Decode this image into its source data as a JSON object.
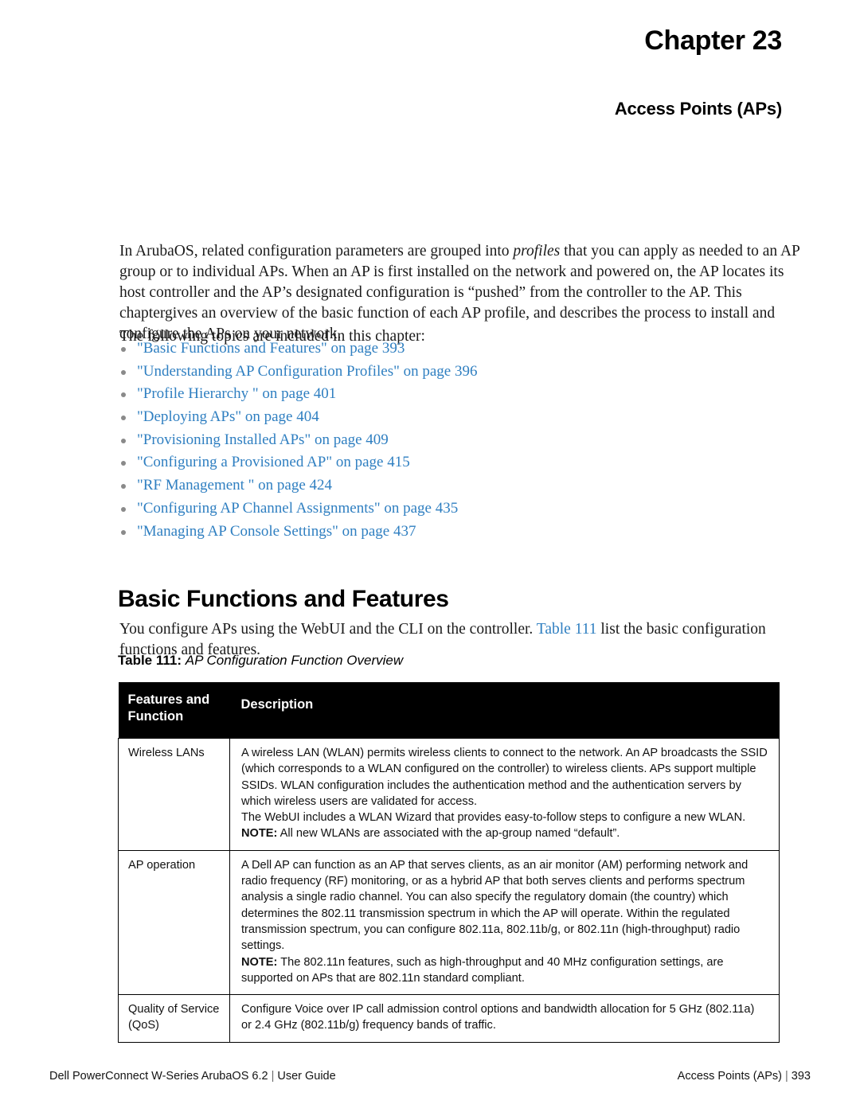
{
  "chapter": {
    "title": "Chapter 23",
    "subtitle": "Access Points (APs)"
  },
  "intro": {
    "part1": "In ArubaOS, related configuration parameters are grouped into ",
    "emphasis": "profiles",
    "part2": " that you can apply as needed to an AP group or to individual APs. When an AP is first installed on the network and powered on, the AP locates its host controller and the AP’s designated configuration is “pushed” from the controller to the AP. This chaptergives an overview of the basic function of each AP profile, and describes the process to install and configure the APs on your network.",
    "topics_lead": "The following topics are included in this chapter:"
  },
  "topics": [
    {
      "label": "\"Basic Functions and Features\" on page 393"
    },
    {
      "label": "\"Understanding AP Configuration Profiles\" on page 396"
    },
    {
      "label": "\"Profile Hierarchy \" on page 401"
    },
    {
      "label": "\"Deploying APs\" on page 404"
    },
    {
      "label": "\"Provisioning Installed APs\" on page 409"
    },
    {
      "label": "\"Configuring a Provisioned AP\" on page 415"
    },
    {
      "label": "\"RF Management \" on page 424"
    },
    {
      "label": "\"Configuring AP Channel Assignments\" on page 435"
    },
    {
      "label": "\"Managing AP Console Settings\" on page 437"
    }
  ],
  "section": {
    "heading": "Basic Functions and Features",
    "para_part1": "You configure APs using the WebUI and the CLI on the controller. ",
    "para_link": "Table 111",
    "para_part2": " list the basic configuration functions and features."
  },
  "table_caption": {
    "label": "Table 111:",
    "text": "AP Configuration Function Overview"
  },
  "table": {
    "headers": {
      "col1": "Features and Function",
      "col2": "Description"
    },
    "rows": [
      {
        "feature": "Wireless LANs",
        "paragraphs": [
          "A wireless LAN (WLAN) permits wireless clients to connect to the network. An AP broadcasts the SSID (which corresponds to a WLAN configured on the controller) to wireless clients. APs support multiple SSIDs. WLAN configuration includes the authentication method and the authentication servers by which wireless users are validated for access.",
          "The WebUI includes a WLAN Wizard that provides easy-to-follow steps to configure a new WLAN."
        ],
        "note_label": "NOTE:",
        "note_text": " All new WLANs are associated with the ap-group named “default”."
      },
      {
        "feature": "AP operation",
        "paragraphs": [
          "A  Dell AP can function as an AP that serves clients, as an air monitor (AM) performing network and radio frequency (RF) monitoring, or as a hybrid AP that both serves clients and performs spectrum analysis a single radio channel. You can also specify the regulatory domain (the country) which determines the 802.11 transmission spectrum in which the AP will operate. Within the regulated transmission spectrum, you can configure 802.11a, 802.11b/g, or 802.11n (high-throughput) radio settings."
        ],
        "note_label": "NOTE:",
        "note_text": " The 802.11n features, such as high-throughput and 40 MHz configuration settings, are supported on APs that are 802.11n standard compliant."
      },
      {
        "feature": "Quality of Service (QoS)",
        "paragraphs": [
          "Configure Voice over IP call admission control options and bandwidth allocation for 5 GHz (802.11a) or 2.4 GHz (802.11b/g) frequency bands of traffic."
        ],
        "note_label": "",
        "note_text": ""
      }
    ]
  },
  "footer": {
    "left_product": "Dell PowerConnect W-Series ArubaOS 6.2",
    "left_separator": "|",
    "left_doc": "User Guide",
    "right_section": "Access Points (APs)",
    "right_separator": "|",
    "right_page": "393"
  },
  "colors": {
    "link": "#2f7fc1",
    "header_bg": "#000000",
    "bullet": "#8a8a8a"
  }
}
